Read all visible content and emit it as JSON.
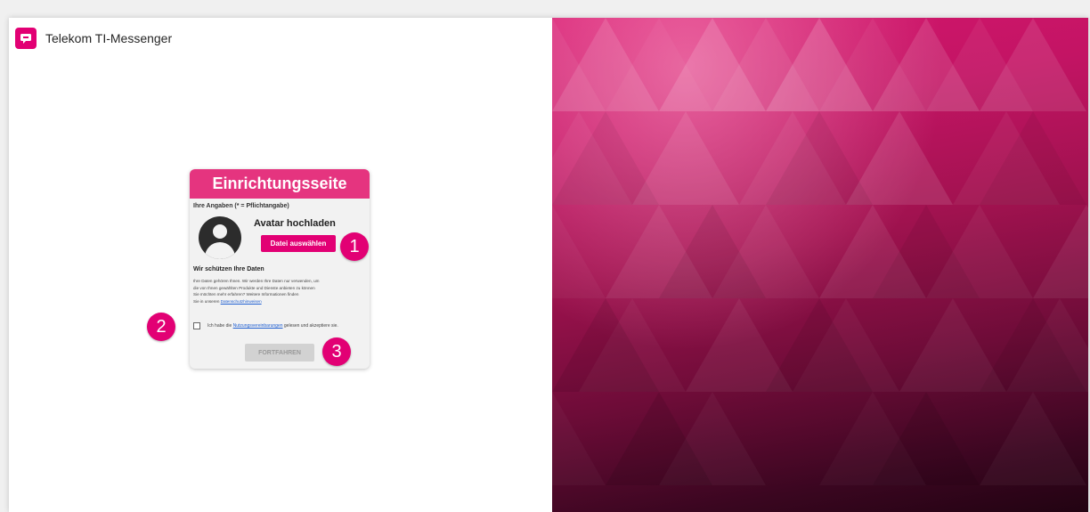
{
  "app": {
    "title": "Telekom TI-Messenger",
    "logo_icon": "telekom-chat-logo-icon",
    "accent_color": "#e20074"
  },
  "card": {
    "header": "Einrichtungsseite",
    "section_label": "Ihre Angaben (* = Pflichtangabe)",
    "avatar_title": "Avatar hochladen",
    "upload_button": "Datei auswählen",
    "privacy_heading": "Wir schützen Ihre Daten",
    "privacy_lines": [
      "Ihre Daten gehören Ihnen. Wir werden Ihre Daten nur verwenden, um",
      "die von Ihnen gewählten Produkte und Dienste anbieten zu können",
      "Sie möchten mehr erfahren? Weitere Informationen finden"
    ],
    "privacy_link_prefix": "Sie in unseren",
    "privacy_link": "Datenschutzhinweisen",
    "terms_prefix": "Ich habe die",
    "terms_link": "Nutzungsvereinbarungen",
    "terms_suffix": "gelesen und akzeptiere sie.",
    "continue_button": "FORTFAHREN"
  },
  "markers": [
    "1",
    "2",
    "3"
  ]
}
